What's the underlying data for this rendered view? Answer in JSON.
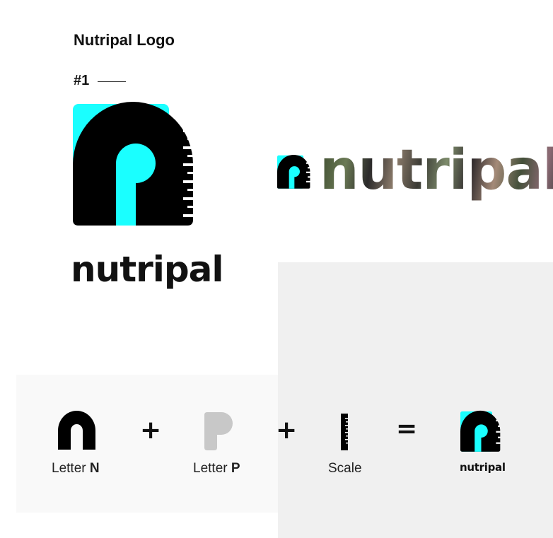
{
  "page": {
    "title": "Nutripal Logo",
    "section_number": "#1"
  },
  "logo_main": {
    "wordmark": "nutripal",
    "accent_color": "#1affff",
    "mark_color": "#000000"
  },
  "logo_horizontal": {
    "wordmark": "nutripal"
  },
  "construction": {
    "items": [
      {
        "label": "Letter ",
        "label_bold": "N",
        "icon": "letter-n-icon"
      },
      {
        "label": "Letter ",
        "label_bold": "P",
        "icon": "letter-p-icon"
      },
      {
        "label": "Scale",
        "label_bold": "",
        "icon": "scale-icon"
      }
    ],
    "operator_plus": "+",
    "operator_equals": "=",
    "result_wordmark": "nutripal"
  }
}
